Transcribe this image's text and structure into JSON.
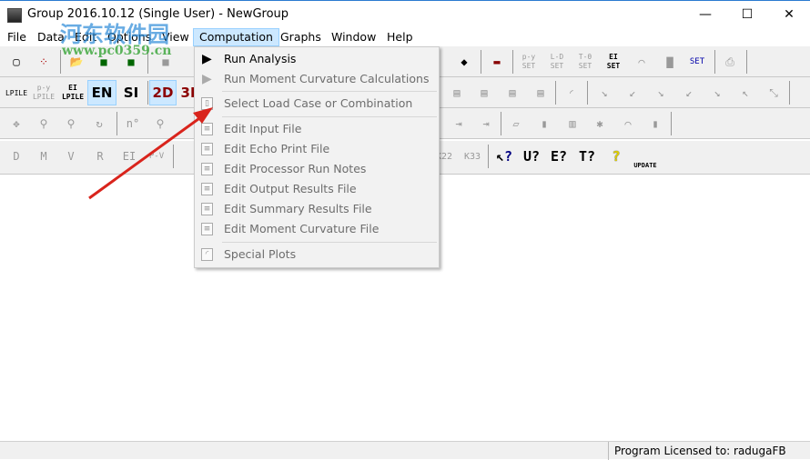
{
  "window": {
    "title": "Group 2016.10.12 (Single User) - NewGroup",
    "minimize": "—",
    "maximize": "☐",
    "close": "✕"
  },
  "menu": [
    "File",
    "Data",
    "Edit",
    "Options",
    "View",
    "Computation",
    "Graphs",
    "Window",
    "Help"
  ],
  "active_menu": "Computation",
  "toolbar1": [
    "new",
    "dice",
    "open",
    "save",
    "save-as",
    "disabled-save",
    "print-preview",
    "pile-head",
    "eraser",
    "soil-layers",
    "p-y SET",
    "L-D SET",
    "T-θ SET",
    "EI SET",
    "curve SET",
    "gray-block",
    "SET",
    "printer"
  ],
  "toolbar2": [
    "LPILE",
    "p-y LPILE",
    "EI LPILE",
    "EN",
    "SI",
    "2D",
    "3D"
  ],
  "toolbar2_labels": {
    "en": "EN",
    "si": "SI",
    "d2": "2D",
    "d3": "3D"
  },
  "toolbar4_labels": [
    "D",
    "M",
    "V",
    "R",
    "EI",
    "P-V",
    "K22",
    "K33",
    "?",
    "U?",
    "E?",
    "T?",
    "?",
    "UPDATE"
  ],
  "dropdown": {
    "items": [
      {
        "label": "Run Analysis",
        "enabled": true,
        "icon": "play-icon"
      },
      {
        "label": "Run Moment Curvature Calculations",
        "enabled": false,
        "icon": "play-gray-icon"
      },
      {
        "label": "Select Load Case or Combination",
        "enabled": false,
        "icon": "load-case-icon"
      },
      {
        "label": "Edit Input File",
        "enabled": false,
        "icon": "file-icon"
      },
      {
        "label": "Edit Echo Print File",
        "enabled": false,
        "icon": "file-icon"
      },
      {
        "label": "Edit Processor Run Notes",
        "enabled": false,
        "icon": "file-icon"
      },
      {
        "label": "Edit Output Results File",
        "enabled": false,
        "icon": "file-icon"
      },
      {
        "label": "Edit Summary Results File",
        "enabled": false,
        "icon": "file-icon"
      },
      {
        "label": "Edit Moment Curvature File",
        "enabled": false,
        "icon": "file-icon"
      },
      {
        "label": "Special Plots",
        "enabled": false,
        "icon": "plot-icon"
      }
    ]
  },
  "watermark": {
    "text": "河东软件园",
    "url": "www.pc0359.cn"
  },
  "status": {
    "license": "Program Licensed to: radugaFB"
  },
  "colors": {
    "menu_highlight": "#cce8ff",
    "arrow": "#d9241c"
  }
}
